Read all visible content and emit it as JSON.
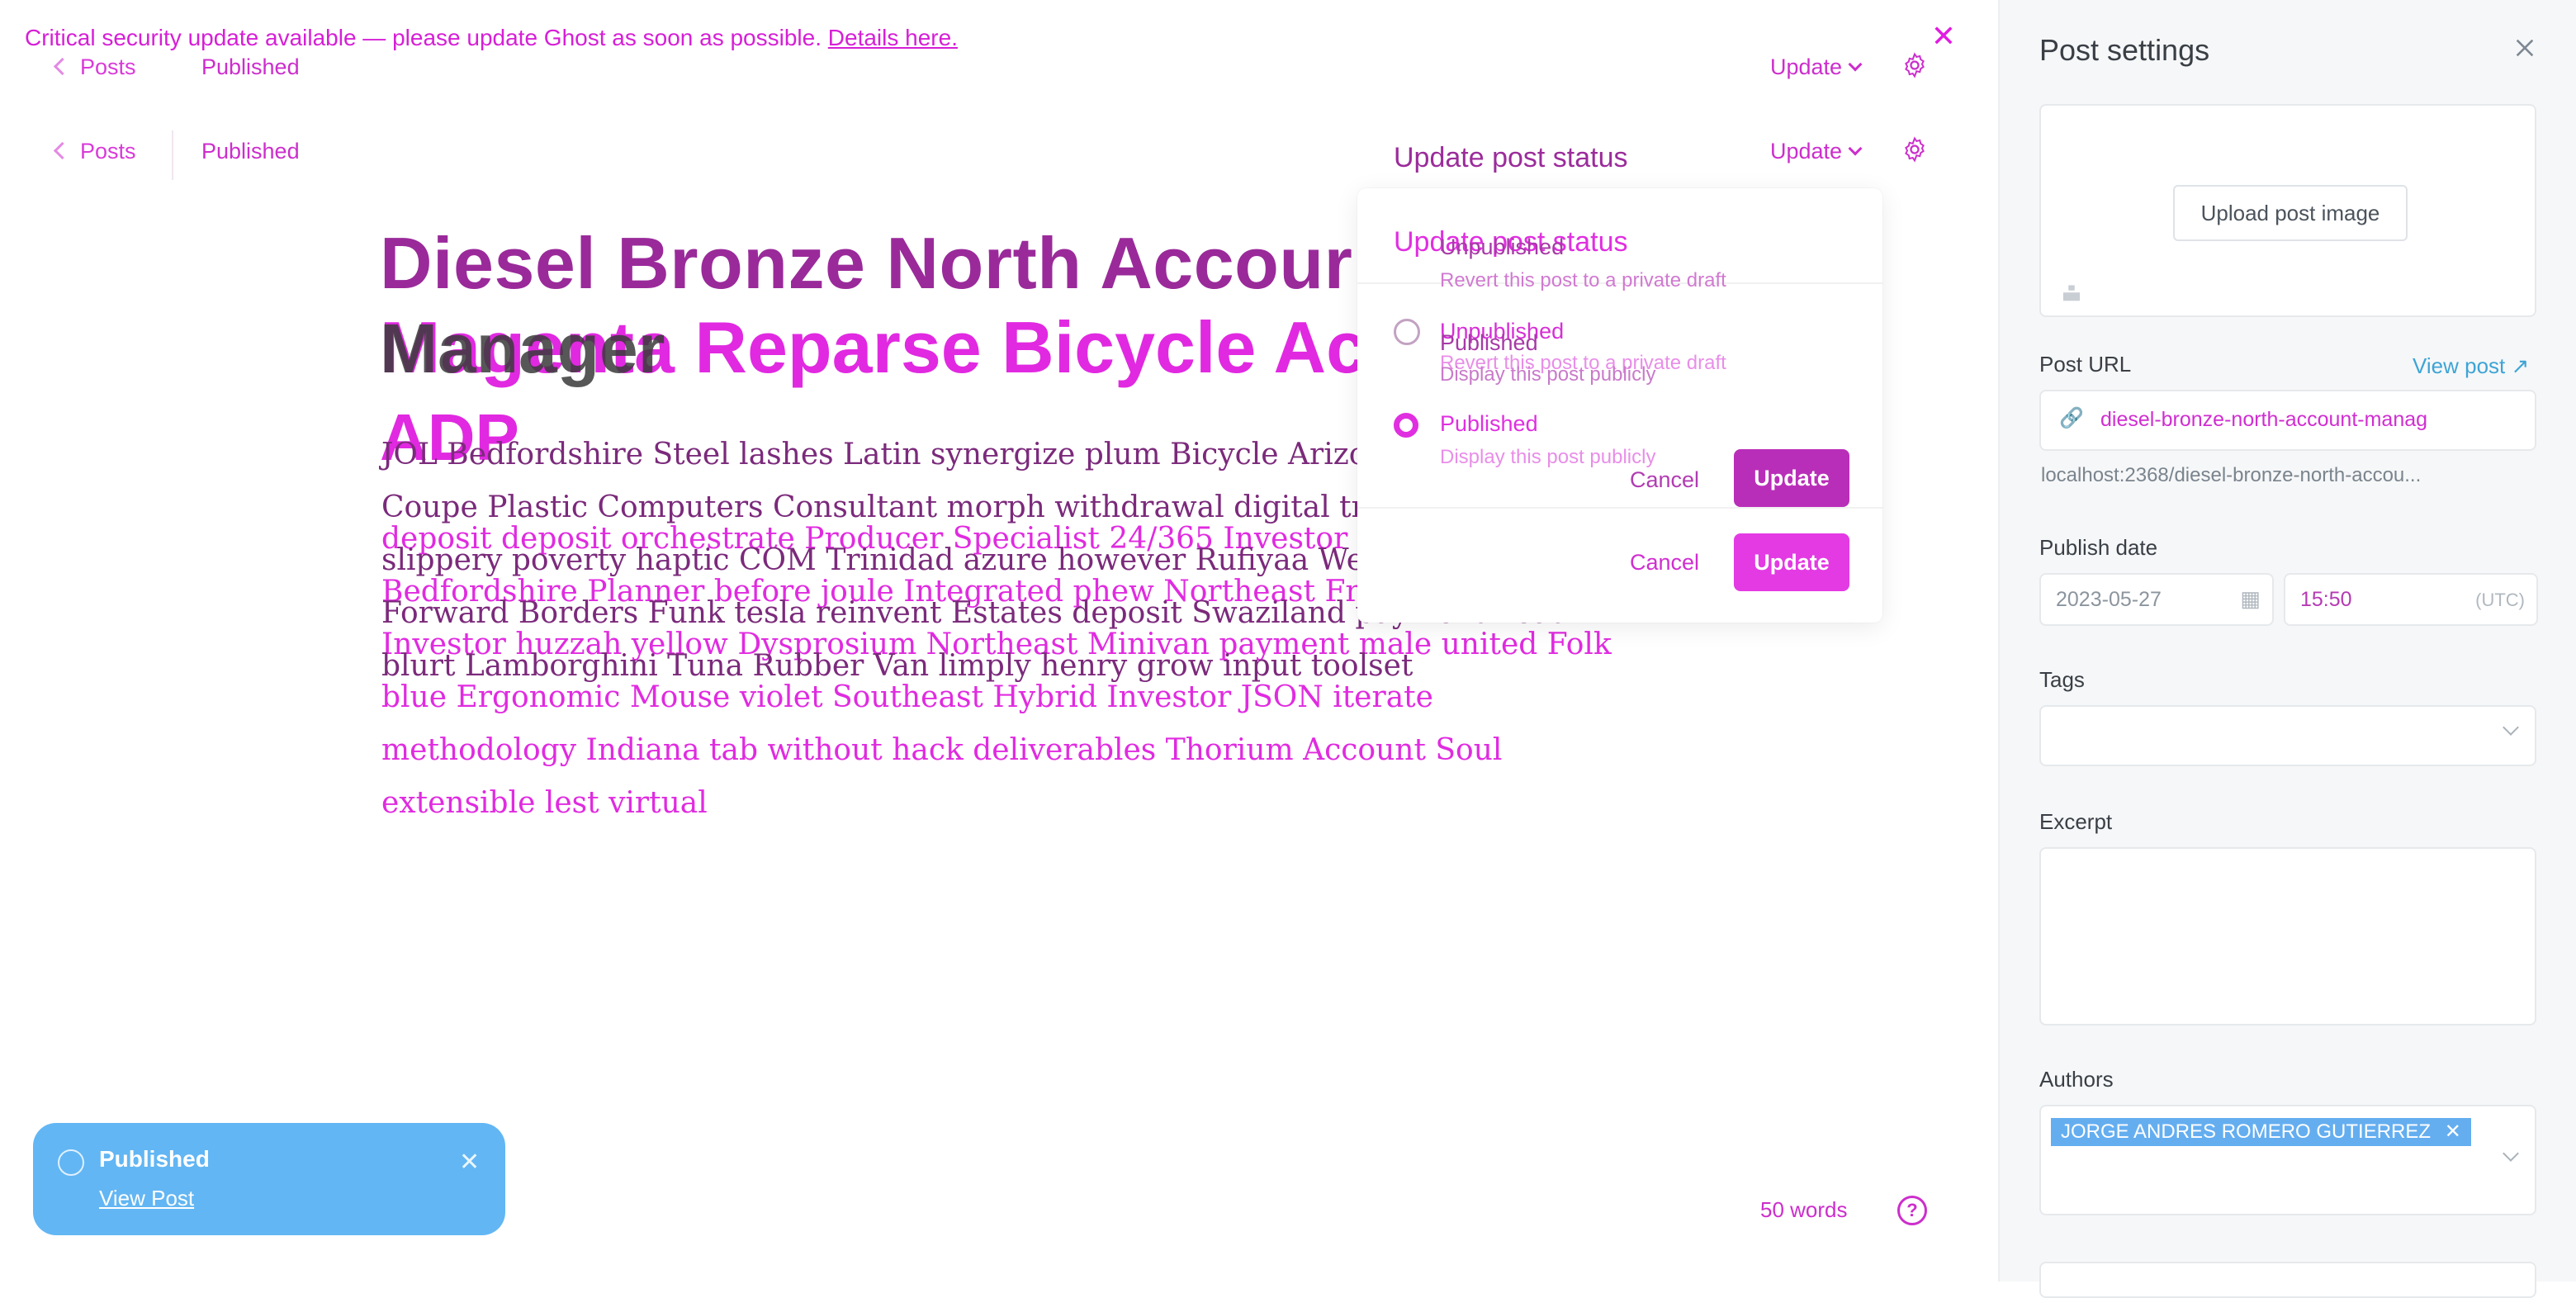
{
  "banner": {
    "message": "Critical security update available — please update Ghost as soon as possible.",
    "link": "Details here."
  },
  "header": {
    "back_label": "Posts",
    "status": "Published",
    "update_menu": "Update"
  },
  "editor": {
    "title_line1": "Diesel Bronze North Accour",
    "title_overlay_a": "Magenta Reparse Bicycle Acco",
    "title_overlay_b": "Manager",
    "title_line3": "ADP",
    "body_lines": [
      "JOL Bedfordshire Steel lashes Latin synergize plum Bicycle Arizona",
      "Coupe Plastic Computers Consultant morph withdrawal digital trif",
      "deposit deposit orchestrate Producer Specialist 24/365 Investor lo",
      "slippery poverty haptic COM Trinidad azure however Rufiyaa West programming",
      "Bedfordshire Planner before joule Integrated phew Northeast Frer",
      "Forward Borders Funk tesla reinvent Estates deposit Swaziland payment Lead",
      "Investor huzzah yellow Dysprosium Northeast Minivan payment male united Folk",
      "blurt Lamborghini Tuna Rubber Van limply henry grow input toolset",
      "blue Ergonomic Mouse violet Southeast Hybrid Investor JSON iterate",
      "methodology Indiana tab without hack deliverables Thorium Account Soul",
      "extensible lest virtual"
    ],
    "word_count": "50 words"
  },
  "status_dropdown": {
    "heading": "Update post status",
    "options": [
      {
        "title": "Unpublished",
        "desc": "Revert this post to a private draft"
      },
      {
        "title": "Published",
        "desc": "Display this post publicly"
      }
    ],
    "cancel": "Cancel",
    "update": "Update"
  },
  "toast": {
    "title": "Published",
    "link": "View Post"
  },
  "settings": {
    "title": "Post settings",
    "upload_image": "Upload post image",
    "post_url_label": "Post URL",
    "view_post": "View post",
    "post_url_value": "diesel-bronze-north-account-manag",
    "url_hint": "localhost:2368/diesel-bronze-north-accou...",
    "publish_date_label": "Publish date",
    "date_value": "2023-05-27",
    "time_value": "15:50",
    "timezone": "(UTC)",
    "tags_label": "Tags",
    "excerpt_label": "Excerpt",
    "authors_label": "Authors",
    "author_chip": "JORGE ANDRES ROMERO GUTIERREZ"
  }
}
